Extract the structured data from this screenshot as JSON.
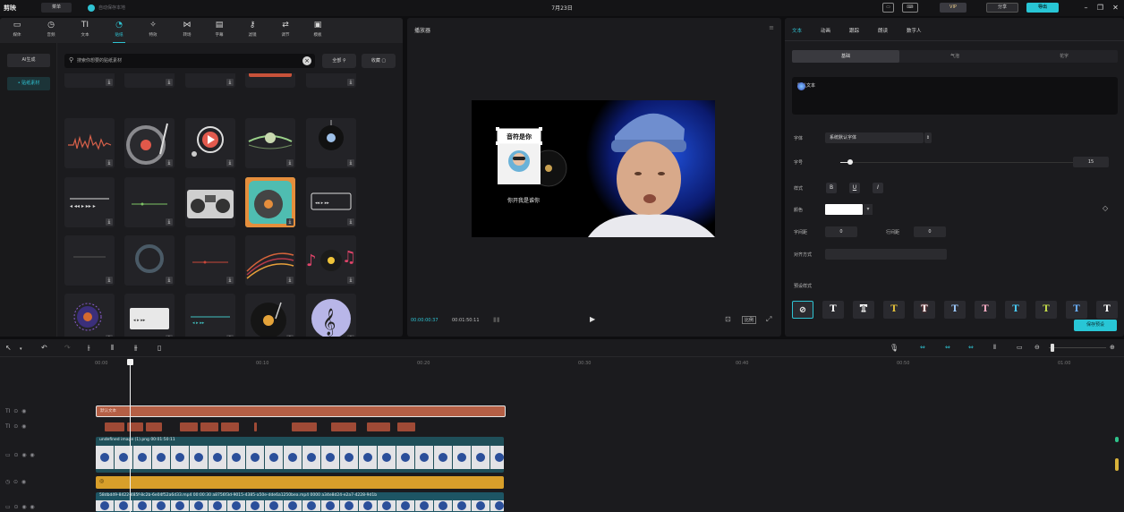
{
  "titlebar": {
    "app_name": "剪映",
    "menu_label": "菜单",
    "autosave": "自动保存本地",
    "project_title": "7月23日",
    "vip_label": "VIP",
    "share_label": "分享",
    "export_label": "导出"
  },
  "toolbar": {
    "items": [
      {
        "label": "媒体",
        "icon": "media-icon"
      },
      {
        "label": "音频",
        "icon": "audio-icon"
      },
      {
        "label": "文本",
        "icon": "text-icon"
      },
      {
        "label": "贴纸",
        "icon": "sticker-icon"
      },
      {
        "label": "特效",
        "icon": "effects-icon"
      },
      {
        "label": "转场",
        "icon": "transition-icon"
      },
      {
        "label": "字幕",
        "icon": "subtitle-icon"
      },
      {
        "label": "滤镜",
        "icon": "filter-icon"
      },
      {
        "label": "调节",
        "icon": "adjust-icon"
      },
      {
        "label": "模板",
        "icon": "template-icon"
      }
    ],
    "active_index": 3
  },
  "subnav": {
    "ai_label": "AI生成",
    "material_label": "• 贴纸素材"
  },
  "search": {
    "placeholder": "搜索你想要的贴纸素材",
    "filter_label": "全部",
    "favorite_label": "收藏"
  },
  "player": {
    "title": "播放器",
    "overlay_title": "音符是你",
    "overlay_caption": "你开我是谁你",
    "current_time": "00:00:00:37",
    "total_time": "00:01:50:11",
    "ratio_label": "比例"
  },
  "inspector": {
    "tabs": [
      "文本",
      "动画",
      "跟踪",
      "朗读",
      "数字人"
    ],
    "active_tab": 0,
    "segments": [
      "基础",
      "气泡",
      "花字"
    ],
    "text_value": "默认文本",
    "font_label": "字体",
    "font_value": "系统默认字体",
    "size_label": "字号",
    "size_value": "15",
    "style_label": "样式",
    "color_label": "颜色",
    "char_spacing_label": "字间距",
    "char_spacing_value": "0",
    "line_spacing_label": "行间距",
    "line_spacing_value": "0",
    "align_label": "对齐方式",
    "preset_label": "预设样式",
    "save_preset_label": "保存预设"
  },
  "timeline": {
    "ticks": [
      "00:00",
      "00:10",
      "00:20",
      "00:30",
      "00:40",
      "00:50",
      "01:00"
    ],
    "text_clip_label": "默认文本",
    "video_caption": "undefined image (1).png  00:01:50:11",
    "bottom_caption": "58dbd49-8422-485f-8c2b-6e04f52a6d33.mp4   00:00:30   a8756f3d-9015-4385-a50e-dde6a1250bea.mp4   0000   a34e8d24-e2a7-4228-9d1b"
  },
  "colors": {
    "accent": "#2fc3d3",
    "text_track": "#b45f45",
    "video_track": "#1f4f59",
    "audio_track": "#d89f2a"
  }
}
